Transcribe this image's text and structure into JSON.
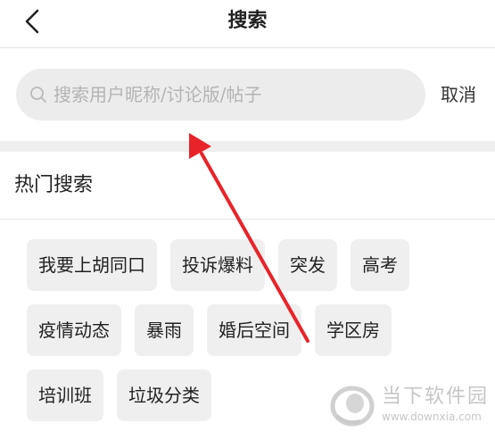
{
  "header": {
    "title": "搜索",
    "back_icon": "chevron-left-icon"
  },
  "search": {
    "placeholder": "搜索用户昵称/讨论版/帖子",
    "value": "",
    "icon": "search-icon",
    "cancel_label": "取消"
  },
  "hot": {
    "title": "热门搜索",
    "rows": [
      [
        "我要上胡同口",
        "投诉爆料",
        "突发",
        "高考"
      ],
      [
        "疫情动态",
        "暴雨",
        "婚后空间",
        "学区房"
      ],
      [
        "培训班",
        "垃圾分类"
      ]
    ]
  },
  "annotation": {
    "arrow_color": "#e8232a"
  },
  "watermark": {
    "logo_icon": "downxia-logo-icon",
    "name": "当下软件园",
    "url": "www.downxia.com"
  }
}
